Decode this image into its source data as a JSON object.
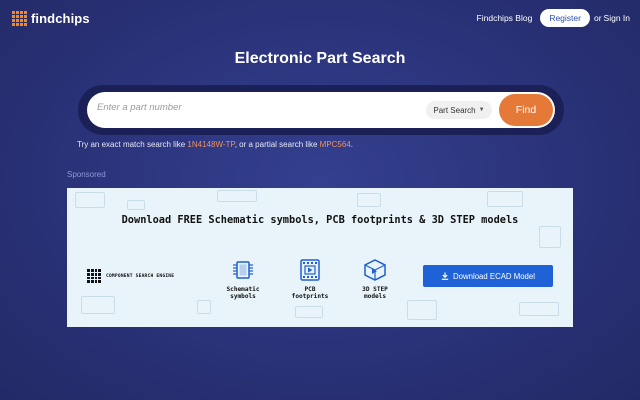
{
  "header": {
    "logo_text": "findchips",
    "nav": {
      "blog": "Findchips Blog",
      "register": "Register",
      "or": "or",
      "signin": "Sign In"
    }
  },
  "hero": {
    "title": "Electronic Part Search"
  },
  "search": {
    "placeholder": "Enter a part number",
    "value": "",
    "type_select": "Part Search",
    "find_label": "Find"
  },
  "hint": {
    "prefix": "Try an exact match search like ",
    "exact_example": "1N4148W-TP",
    "middle": ", or a partial search like ",
    "partial_example": "MPC564",
    "suffix": "."
  },
  "sponsored_label": "Sponsored",
  "ad": {
    "title": "Download FREE Schematic symbols, PCB footprints & 3D STEP models",
    "brand": "COMPONENT SEARCH ENGINE",
    "features": [
      {
        "icon": "chip-icon",
        "line1": "Schematic",
        "line2": "symbols"
      },
      {
        "icon": "pcb-footprint-icon",
        "line1": "PCB",
        "line2": "footprints"
      },
      {
        "icon": "cube-3d-icon",
        "line1": "3D STEP",
        "line2": "models"
      }
    ],
    "button_label": "Download ECAD Model"
  },
  "colors": {
    "background": "#2a3279",
    "search_frame": "#1b2057",
    "accent_orange": "#e57a38",
    "link_orange": "#f0915a",
    "ad_background": "#e8f4fa",
    "download_blue": "#1f62d8",
    "register_text": "#2d4db3"
  }
}
